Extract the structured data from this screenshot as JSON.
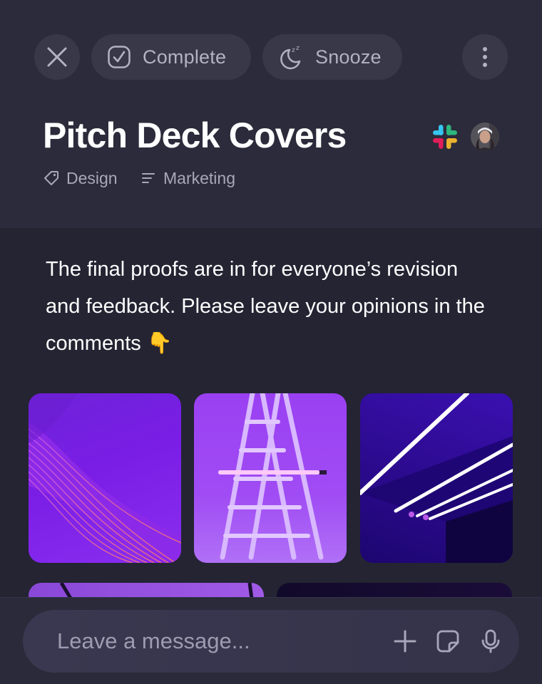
{
  "toolbar": {
    "complete_label": "Complete",
    "snooze_label": "Snooze"
  },
  "task": {
    "title": "Pitch Deck Covers",
    "tags": [
      {
        "label": "Design",
        "icon": "tag-icon"
      },
      {
        "label": "Marketing",
        "icon": "lines-icon"
      }
    ],
    "integrations": [
      "slack-icon"
    ],
    "description": "The final proofs are in for everyone’s revision and feedback. Please leave your opinions in the comments 👇"
  },
  "attachments": [
    {
      "name": "purple-wave-abstract"
    },
    {
      "name": "ladder-neon-tube"
    },
    {
      "name": "neon-ceiling-lines"
    },
    {
      "name": "purple-arch"
    },
    {
      "name": "dark-gradient"
    }
  ],
  "composer": {
    "placeholder": "Leave a message..."
  },
  "colors": {
    "background": "#242433",
    "header": "#2b2b3b",
    "pill": "#383848",
    "muted_text": "#b3b2c2",
    "accent_purple": "#8a2ef0"
  }
}
